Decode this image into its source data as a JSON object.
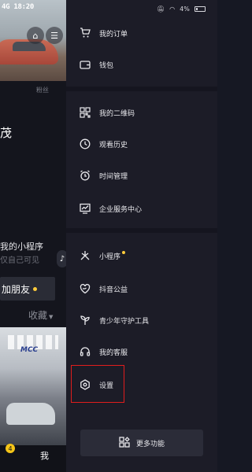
{
  "background_page": {
    "status_time": "4G 18:20",
    "fans_label": "粉丝",
    "name_fragment": "茂",
    "mini_program_title": "我的小程序",
    "mini_program_sub": "仅自己可见",
    "add_friend_label": "加朋友",
    "tab_favorites": "收藏",
    "video_brand": "MCC",
    "bottom_badge": "4",
    "bottom_me": "我"
  },
  "status_bar": {
    "battery": "4%"
  },
  "drawer": {
    "groups": [
      {
        "items": [
          {
            "label": "我的订单",
            "icon": "order-icon"
          },
          {
            "label": "钱包",
            "icon": "wallet-icon"
          }
        ]
      },
      {
        "items": [
          {
            "label": "我的二维码",
            "icon": "qr-code-icon"
          },
          {
            "label": "观看历史",
            "icon": "clock-icon"
          },
          {
            "label": "时间管理",
            "icon": "alarm-icon"
          },
          {
            "label": "企业服务中心",
            "icon": "chart-screen-icon"
          }
        ]
      },
      {
        "items": [
          {
            "label": "小程序",
            "icon": "mini-program-icon",
            "new_dot": true
          },
          {
            "label": "抖音公益",
            "icon": "heart-hand-icon"
          },
          {
            "label": "青少年守护工具",
            "icon": "sprout-icon"
          },
          {
            "label": "我的客服",
            "icon": "headset-icon"
          },
          {
            "label": "设置",
            "icon": "settings-hex-icon"
          }
        ]
      }
    ],
    "more_button": "更多功能"
  },
  "colors": {
    "drawer_bg": "#1c1c27",
    "highlight_border": "#e11d1d",
    "new_dot": "#ffcc3b"
  }
}
